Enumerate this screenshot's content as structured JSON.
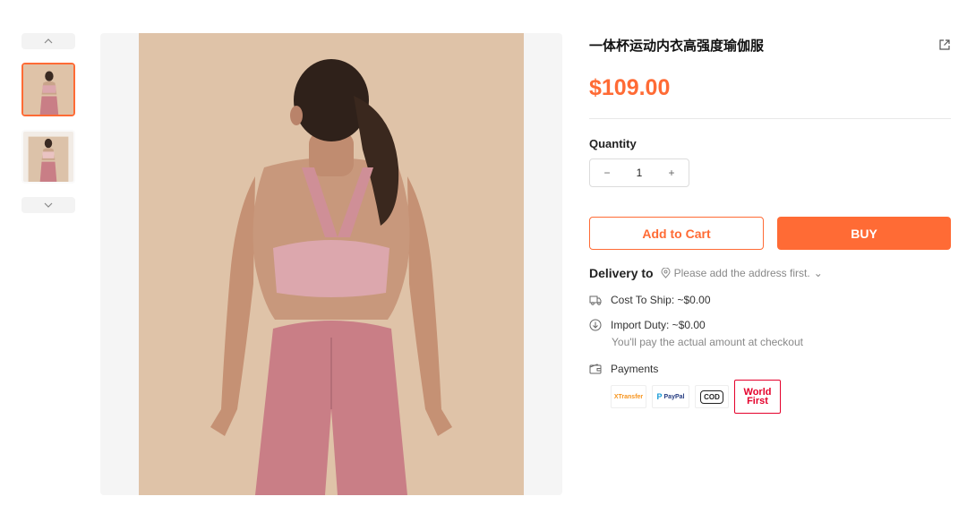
{
  "gallery": {
    "up_icon": "chevron-up-icon",
    "down_icon": "chevron-down-icon",
    "thumbnails": [
      {
        "label": "back view thumbnail",
        "active": true
      },
      {
        "label": "front view thumbnail",
        "active": false
      }
    ]
  },
  "product": {
    "title": "一体杯运动内衣高强度瑜伽服",
    "price": "$109.00",
    "share_icon": "share-icon"
  },
  "quantity": {
    "label": "Quantity",
    "minus": "−",
    "value": "1",
    "plus": "+"
  },
  "actions": {
    "add_to_cart": "Add to Cart",
    "buy": "BUY"
  },
  "delivery": {
    "label": "Delivery to",
    "address_placeholder": "Please add the address first.",
    "chevron": "⌄"
  },
  "costs": {
    "ship": "Cost To Ship: ~$0.00",
    "duty": "Import Duty: ~$0.00",
    "duty_note": "You'll pay the actual amount at checkout",
    "payments": "Payments"
  },
  "payment_methods": {
    "xtransfer": "XTransfer",
    "paypal": "PayPal",
    "cod": "COD",
    "worldfirst_line1": "World",
    "worldfirst_line2": "First"
  },
  "colors": {
    "accent": "#ff6b35",
    "background_photo": "#dfc3a8",
    "garment": "#c97e86"
  }
}
